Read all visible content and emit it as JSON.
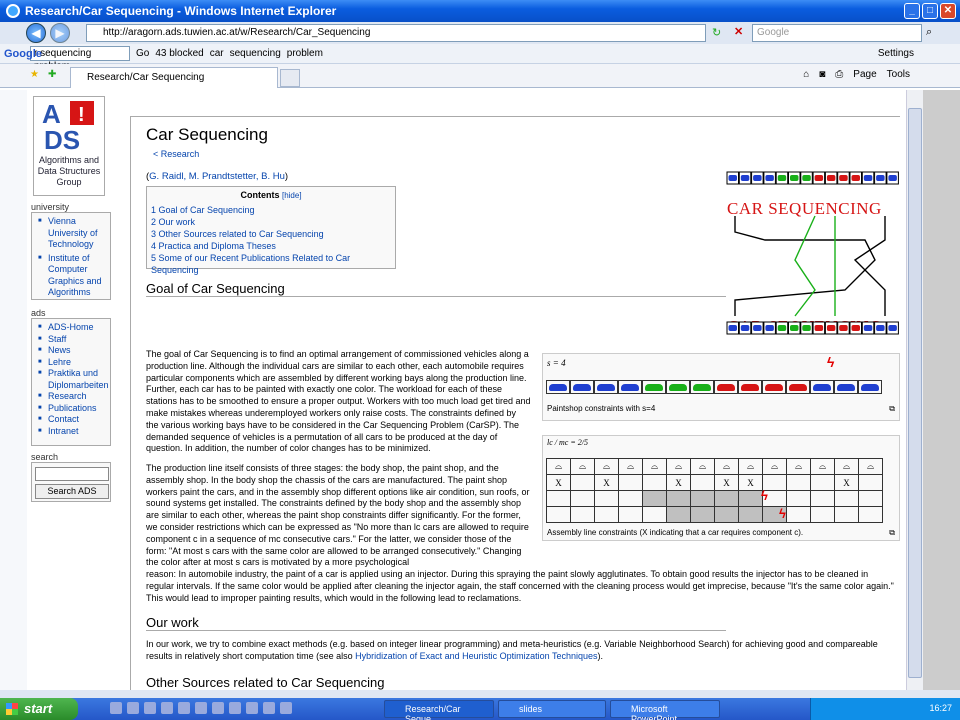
{
  "window": {
    "title": "Research/Car Sequencing - Windows Internet Explorer"
  },
  "address_bar": {
    "url": "http://aragorn.ads.tuwien.ac.at/w/Research/Car_Sequencing",
    "search_placeholder": "Google"
  },
  "google_toolbar": {
    "query": "r sequencing problem",
    "go": "Go",
    "blocked": "43 blocked",
    "terms": [
      "car",
      "sequencing",
      "problem"
    ],
    "settings": "Settings"
  },
  "tab": {
    "title": "Research/Car Sequencing"
  },
  "commands": {
    "page": "Page",
    "tools": "Tools"
  },
  "sidebar": {
    "logo_text": "Algorithms and Data Structures Group",
    "logo_letters": "A DS",
    "university": {
      "heading": "university",
      "items": [
        "Vienna University of Technology",
        "Institute of Computer Graphics and Algorithms"
      ]
    },
    "ads": {
      "heading": "ads",
      "items": [
        "ADS-Home",
        "Staff",
        "News",
        "Lehre",
        "Praktika und Diplomarbeiten",
        "Research",
        "Publications",
        "Contact",
        "Intranet"
      ]
    },
    "search": {
      "heading": "search",
      "button": "Search ADS"
    }
  },
  "article": {
    "title": "Car Sequencing",
    "breadcrumb": "< Research",
    "authors_open": "(",
    "authors": "G. Raidl, M. Prandtstetter, B. Hu",
    "authors_close": ")",
    "toc": {
      "heading": "Contents",
      "hide": "[hide]",
      "items": [
        "1 Goal of Car Sequencing",
        "2 Our work",
        "3 Other Sources related to Car Sequencing",
        "4 Practica and Diploma Theses",
        "5 Some of our Recent Publications Related to Car Sequencing"
      ]
    },
    "h_goal": "Goal of Car Sequencing",
    "p1": "The goal of Car Sequencing is to find an optimal arrangement of commissioned vehicles along a production line. Although the individual cars are similar to each other, each automobile requires particular components which are assembled by different working bays along the production line. Further, each car has to be painted with exactly one color. The workload for each of these stations has to be smoothed to ensure a proper output. Workers with too much load get tired and make mistakes whereas underemployed workers only raise costs. The constraints defined by the various working bays have to be considered in the Car Sequencing Problem (CarSP). The demanded sequence of vehicles is a permutation of all cars to be produced at the day of question. In addition, the number of color changes has to be minimized.",
    "p2": "The production line itself consists of three stages: the body shop, the paint shop, and the assembly shop. In the body shop the chassis of the cars are manufactured. The paint shop workers paint the cars, and in the assembly shop different options like air condition, sun roofs, or sound systems get installed. The constraints defined by the body shop and the assembly shop are similar to each other, whereas the paint shop constraints differ significantly. For the former, we consider restrictions which can be expressed as \"No more than lc cars are allowed to require component c in a sequence of mc consecutive cars.\" For the latter, we consider those of the form: \"At most s cars with the same color are allowed to be arranged consecutively.\" Changing the color after at most s cars is motivated by a more psychological",
    "p2b": "reason: In automobile industry, the paint of a car is applied using an injector. During this spraying the paint slowly agglutinates. To obtain good results the injector has to be cleaned in regular intervals. If the same color would be applied after cleaning the injector again, the staff concerned with the cleaning process would get imprecise, because \"It's the same color again.\" This would lead to improper painting results, which would in the following lead to reclamations.",
    "h_work": "Our work",
    "p3": "In our work, we try to combine exact methods (e.g. based on integer linear programming) and meta-heuristics (e.g. Variable Neighborhood Search) for achieving good and compareable results in relatively short computation time (see also ",
    "p3_link": "Hybridization of Exact and Heuristic Optimization Techniques",
    "p3_end": ").",
    "h_other": "Other Sources related to Car Sequencing",
    "fig_logo_text": "CAR SEQUENCING",
    "fig1_label": "s = 4",
    "fig1_caption": "Paintshop constraints with s=4",
    "fig2_label": "lc / mc = 2/5",
    "fig2_caption": "Assembly line constraints (X indicating that a car requires component c).",
    "grid_marks": [
      "X",
      "",
      "X",
      "",
      "",
      "X",
      "",
      "X",
      "X",
      "",
      "",
      "",
      "X",
      ""
    ]
  },
  "colors": {
    "cars": [
      "#1f3fd0",
      "#1f3fd0",
      "#1f3fd0",
      "#1f3fd0",
      "#19b019",
      "#19b019",
      "#19b019",
      "#d61515",
      "#d61515",
      "#d61515",
      "#d61515",
      "#1f3fd0",
      "#1f3fd0",
      "#1f3fd0"
    ]
  },
  "taskbar": {
    "start": "start",
    "tasks": [
      "Research/Car Seque...",
      "slides",
      "Microsoft PowerPoint ..."
    ],
    "clock": "16:27"
  }
}
